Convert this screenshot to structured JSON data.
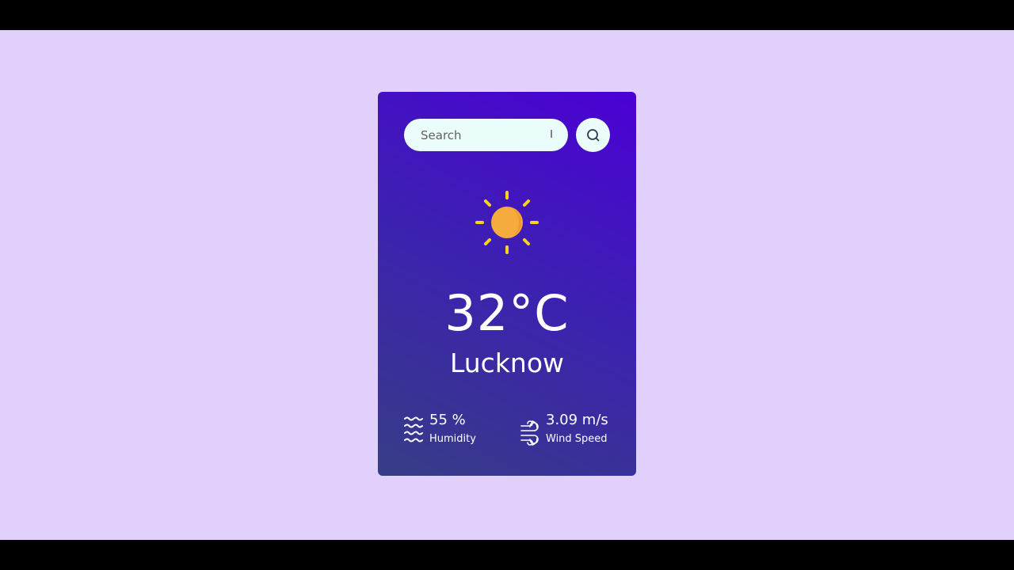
{
  "search": {
    "placeholder": "Search",
    "value": ""
  },
  "weather": {
    "icon": "sun-icon",
    "temperature": "32°C",
    "city": "Lucknow"
  },
  "stats": {
    "humidity": {
      "value": "55 %",
      "label": "Humidity",
      "icon": "humidity-waves-icon"
    },
    "wind": {
      "value": "3.09 m/s",
      "label": "Wind Speed",
      "icon": "wind-icon"
    }
  },
  "colors": {
    "background": "#e0d0fb",
    "card_top": "#4b00d5",
    "card_bottom": "#373d86",
    "input_bg": "#ebfdfa",
    "sun_core": "#f5ac3d",
    "sun_rays": "#fdd21f"
  }
}
